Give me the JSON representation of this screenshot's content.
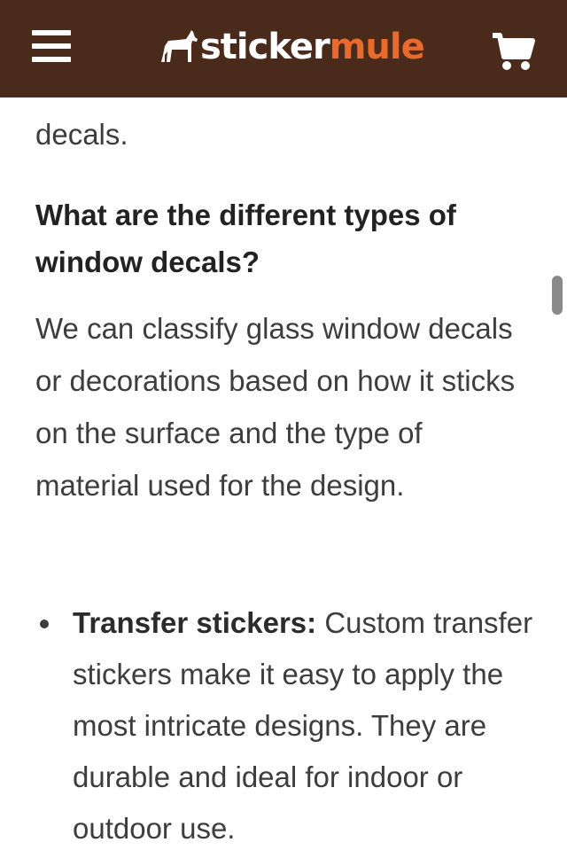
{
  "header": {
    "logo_part1": "sticker",
    "logo_part2": "mule",
    "menu_icon": "hamburger-menu-icon",
    "cart_icon": "shopping-cart-icon",
    "background_color": "#4a2a1a",
    "accent_color": "#e86a2c"
  },
  "article": {
    "top_fragment": "decals.",
    "heading": "What are the different types of window decals?",
    "intro_paragraph": "We can classify glass window decals or decorations based on how it sticks on the surface and the type of material used for the design.",
    "bullets": [
      {
        "term": "Transfer stickers:",
        "text": " Custom transfer stickers make it easy to apply the most intricate designs. They are durable and ideal for indoor or outdoor use."
      }
    ]
  }
}
